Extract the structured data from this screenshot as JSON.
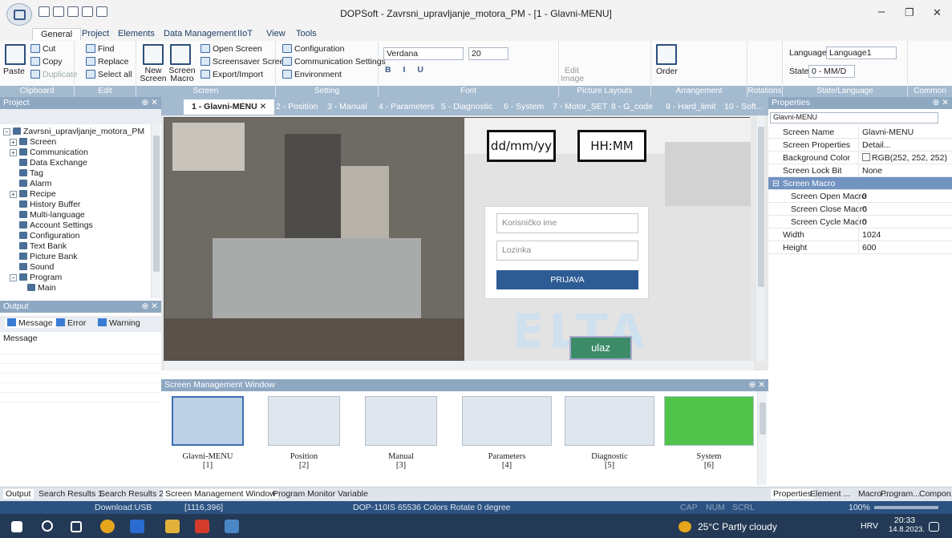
{
  "window": {
    "title": "DOPSoft - Zavrsni_upravljanje_motora_PM - [1 - Glavni-MENU]",
    "min": "–",
    "max": "❐",
    "close": "✕"
  },
  "ribbon_tabs": [
    "General",
    "Project",
    "Elements",
    "Data Management",
    "IIoT",
    "View",
    "Tools"
  ],
  "clipboard": {
    "paste": "Paste",
    "cut": "Cut",
    "copy": "Copy",
    "duplicate": "Duplicate",
    "label": "Clipboard"
  },
  "edit": {
    "find": "Find",
    "replace": "Replace",
    "select_all": "Select all",
    "label": "Edit"
  },
  "screen": {
    "new": "New Screen",
    "screen_macro": "Screen Macro",
    "open_screen": "Open Screen",
    "screensaver": "Screensaver Screen",
    "export": "Export/Import",
    "label": "Screen"
  },
  "setting": {
    "configuration": "Configuration",
    "comm": "Communication Settings",
    "environment": "Environment",
    "label": "Setting"
  },
  "font": {
    "family": "Verdana",
    "size": "20",
    "label": "Font"
  },
  "picture": {
    "edit_image": "Edit Image",
    "label": "Picture Layouts"
  },
  "arrangement": {
    "order": "Order",
    "label": "Arrangement"
  },
  "rotations": {
    "label": "Rotations"
  },
  "state_language": {
    "language_label": "Language",
    "language_value": "Language1",
    "state_label": "State",
    "state_value": "0 - MM/D",
    "label": "State/Language"
  },
  "common": {
    "label": "Common"
  },
  "project_panel": {
    "title": "Project",
    "pin": "⊕ ✕",
    "root": "Zavrsni_upravljanje_motora_PM",
    "items": [
      "Screen",
      "Communication",
      "Data Exchange",
      "Tag",
      "Alarm",
      "Recipe",
      "History Buffer",
      "Multi-language",
      "Account Settings",
      "Configuration",
      "Text Bank",
      "Picture Bank",
      "Sound",
      "Program",
      "Main"
    ]
  },
  "output_panel": {
    "title": "Output",
    "pin": "⊕ ✕",
    "tabs": [
      "Message",
      "Error",
      "Warning"
    ],
    "column": "Message"
  },
  "doc_tabs": [
    "1 - Glavni-MENU",
    "2 - Position",
    "3 - Manual",
    "4 - Parameters",
    "5 - Diagnostic",
    "6 - System",
    "7 - Motor_SET",
    "8 - G_code",
    "9 - Hard_limit",
    "10 - Soft..."
  ],
  "screen_content": {
    "date": "dd/mm/yy",
    "time": "HH:MM",
    "username": "Korisničko ime",
    "password": "Lozinka",
    "login": "PRIJAVA",
    "enter": "ulaz",
    "watermark": "ELTA"
  },
  "smw": {
    "title": "Screen Management Window",
    "pin": "⊕ ✕",
    "screens": [
      {
        "name": "Glavni-MENU",
        "num": "[1]"
      },
      {
        "name": "Position",
        "num": "[2]"
      },
      {
        "name": "Manual",
        "num": "[3]"
      },
      {
        "name": "Parameters",
        "num": "[4]"
      },
      {
        "name": "Diagnostic",
        "num": "[5]"
      },
      {
        "name": "System",
        "num": "[6]"
      }
    ]
  },
  "properties": {
    "title": "Properties",
    "pin": "⊕ ✕",
    "object": "Glavni-MENU",
    "rows": [
      {
        "k": "Screen Name",
        "v": "Glavni-MENU"
      },
      {
        "k": "Screen Properties",
        "v": "Detail..."
      },
      {
        "k": "Background Color",
        "v": "RGB(252, 252, 252)"
      },
      {
        "k": "Screen Lock Bit",
        "v": "None"
      }
    ],
    "section": "Screen Macro",
    "macro_rows": [
      {
        "k": "Screen Open Macro",
        "v": "0"
      },
      {
        "k": "Screen Close Macro",
        "v": "0"
      },
      {
        "k": "Screen Cycle Macro",
        "v": "0"
      }
    ],
    "size_rows": [
      {
        "k": "Width",
        "v": "1024"
      },
      {
        "k": "Height",
        "v": "600"
      }
    ]
  },
  "bottom_tabs": {
    "left": [
      "Output",
      "Search Results 1",
      "Search Results 2"
    ],
    "center": [
      "Screen Management Window",
      "Program Monitor Variable"
    ],
    "right": [
      "Properties",
      "Element ...",
      "Macro ...",
      "Program...",
      "Compon..."
    ]
  },
  "status": {
    "download": "Download:USB",
    "coords": "[1116,396]",
    "device": "DOP-110IS 65536 Colors Rotate 0 degree",
    "cap": "CAP",
    "num": "NUM",
    "scrl": "SCRL",
    "zoom": "100%"
  },
  "taskbar": {
    "weather": "25°C  Partly cloudy",
    "lang": "HRV",
    "time": "20:33",
    "date": "14.8.2023."
  },
  "colors": {
    "accent": "#2c5281",
    "panel": "#8ea8c2",
    "tabbar": "#a4bacf",
    "button": "#2c5c93",
    "enter_button": "#3c8c6a"
  }
}
